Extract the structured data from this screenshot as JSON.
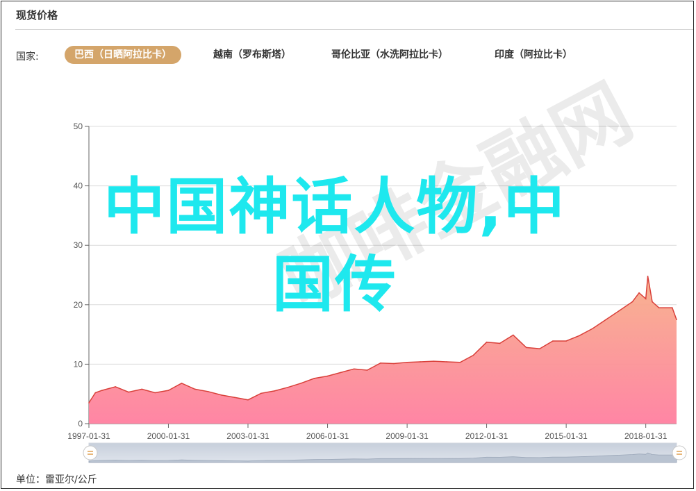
{
  "panel": {
    "title": "现货价格",
    "filter_label": "国家:",
    "tabs": [
      {
        "label": "巴西（日晒阿拉比卡）",
        "active": true
      },
      {
        "label": "越南（罗布斯塔）",
        "active": false
      },
      {
        "label": "哥伦比亚（水洗阿拉比卡）",
        "active": false
      },
      {
        "label": "印度（阿拉比卡）",
        "active": false
      }
    ],
    "unit": "单位：雷亚尔/公斤"
  },
  "overlay": {
    "headline_line1": "中国神话人物,中",
    "headline_line2": "国传",
    "watermark": "咖啡金融网"
  },
  "colors": {
    "accent": "#d4a56a",
    "series_line": "#d9403a",
    "area_top": "#f7b08a",
    "area_bottom": "#ff7fa0",
    "overlay_text": "#1ee8ee"
  },
  "chart_data": {
    "type": "area",
    "title": "",
    "xlabel": "",
    "ylabel": "",
    "ylim": [
      0,
      50
    ],
    "yticks": [
      0,
      10,
      20,
      30,
      40,
      50
    ],
    "x_range": [
      "1997-01-31",
      "2019-03-31"
    ],
    "xtick_labels": [
      "1997-01-31",
      "2000-01-31",
      "2003-01-31",
      "2006-01-31",
      "2009-01-31",
      "2012-01-31",
      "2015-01-31",
      "2018-01-31"
    ],
    "grid": true,
    "series": [
      {
        "x": [
          "1997-01-31",
          "1997-04-30",
          "1997-07-31",
          "1998-01-31",
          "1998-07-31",
          "1999-01-31",
          "1999-07-31",
          "2000-01-31",
          "2000-07-31",
          "2001-01-31",
          "2001-07-31",
          "2002-01-31",
          "2002-07-31",
          "2003-01-31",
          "2003-07-31",
          "2004-01-31",
          "2004-07-31",
          "2005-01-31",
          "2005-07-31",
          "2006-01-31",
          "2006-07-31",
          "2007-01-31",
          "2007-07-31",
          "2008-01-31",
          "2008-07-31",
          "2009-01-31",
          "2009-07-31",
          "2010-01-31",
          "2010-07-31",
          "2011-01-31",
          "2011-07-31",
          "2012-01-31",
          "2012-07-31",
          "2013-01-31",
          "2013-07-31",
          "2014-01-31",
          "2014-07-31",
          "2015-01-31",
          "2015-07-31",
          "2016-01-31",
          "2016-07-31",
          "2017-01-31",
          "2017-07-31",
          "2017-10-31",
          "2018-01-31",
          "2018-02-28",
          "2018-04-30",
          "2018-07-31",
          "2019-01-31",
          "2019-03-31"
        ],
        "y": [
          3.5,
          5.2,
          5.6,
          6.2,
          5.3,
          5.8,
          5.2,
          5.6,
          6.8,
          5.8,
          5.4,
          4.8,
          4.4,
          4.0,
          5.1,
          5.5,
          6.1,
          6.8,
          7.6,
          8.0,
          8.6,
          9.2,
          9.0,
          10.2,
          10.1,
          10.3,
          10.4,
          10.5,
          10.4,
          10.3,
          11.5,
          13.7,
          13.5,
          14.9,
          12.8,
          12.6,
          13.9,
          13.9,
          14.8,
          16.0,
          17.5,
          19.0,
          20.5,
          22.0,
          21.0,
          24.8,
          20.5,
          19.5,
          19.5,
          17.5
        ]
      }
    ]
  }
}
